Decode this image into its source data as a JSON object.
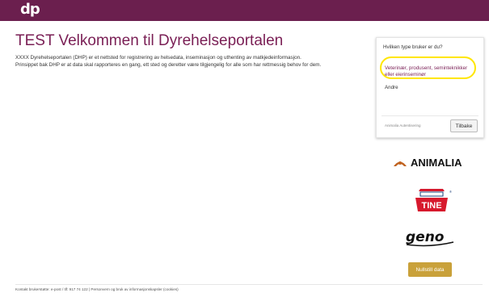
{
  "header": {
    "logo_text": "dp",
    "background": "#6b1f4e"
  },
  "main": {
    "title": "TEST Velkommen til Dyrehelseportalen",
    "intro_line1": "XXXX Dyrehelseportalen (DHP) er et nettsted for registrering av helsedata, inseminasjon og uthenting av matkjedeinformasjon.",
    "intro_line2": "Prinsippet bak DHP er at data skal rapporteres en gang, ett sted og deretter være tilgjengelig for alle som har rettmessig behov for dem."
  },
  "login_box": {
    "title": "Hvilken type bruker er du?",
    "options": [
      {
        "label": "Veterinær, produsent, seminteknikker eller eierinseminør",
        "highlighted": true
      },
      {
        "label": "Andre",
        "highlighted": false
      }
    ],
    "highlight_color": "#ffe600",
    "footer_text": "Animalia Autentisering",
    "back_button": "Tilbake"
  },
  "partners": {
    "animalia": "ANIMALIA",
    "tine": "TINE",
    "geno": "geno",
    "animalia_color": "#111111",
    "animalia_accent": "#c0621f",
    "tine_color": "#d7192d"
  },
  "reset_button": "Nullstill data",
  "reset_color": "#c9a13a",
  "footer": {
    "contact": "Kontakt brukerstøtte: e-post / tlf: 917 74 122",
    "separator": " | ",
    "privacy": "Personvern og bruk av informasjonskapsler (cookies)"
  }
}
